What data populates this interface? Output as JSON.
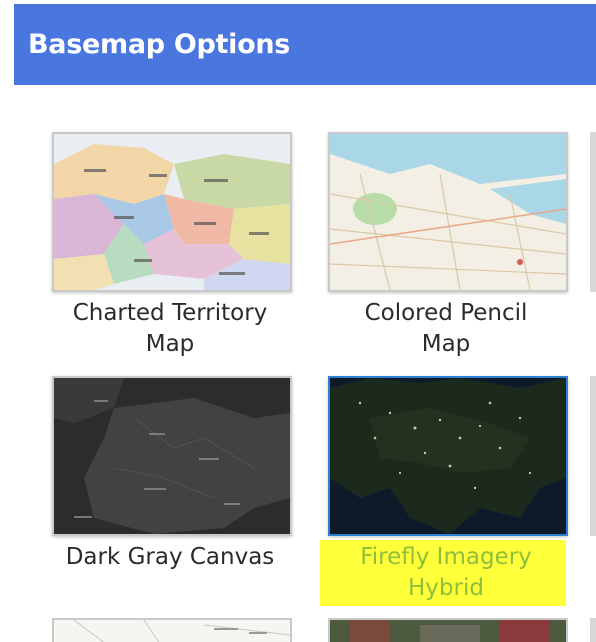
{
  "header": {
    "title": "Basemap Options",
    "background": "#4a76e0"
  },
  "basemaps": [
    {
      "line1": "Charted Territory",
      "line2": "Map",
      "selected": false
    },
    {
      "line1": "Colored Pencil",
      "line2": "Map",
      "selected": false
    },
    {
      "line1": "Dark Gray Canvas",
      "line2": "",
      "selected": false
    },
    {
      "line1": "Firefly Imagery",
      "line2": "Hybrid",
      "selected": true
    }
  ],
  "colors": {
    "selected_label": "#8fbf3a",
    "highlight": "#ffff3a",
    "selected_border": "#2f7fd0"
  }
}
